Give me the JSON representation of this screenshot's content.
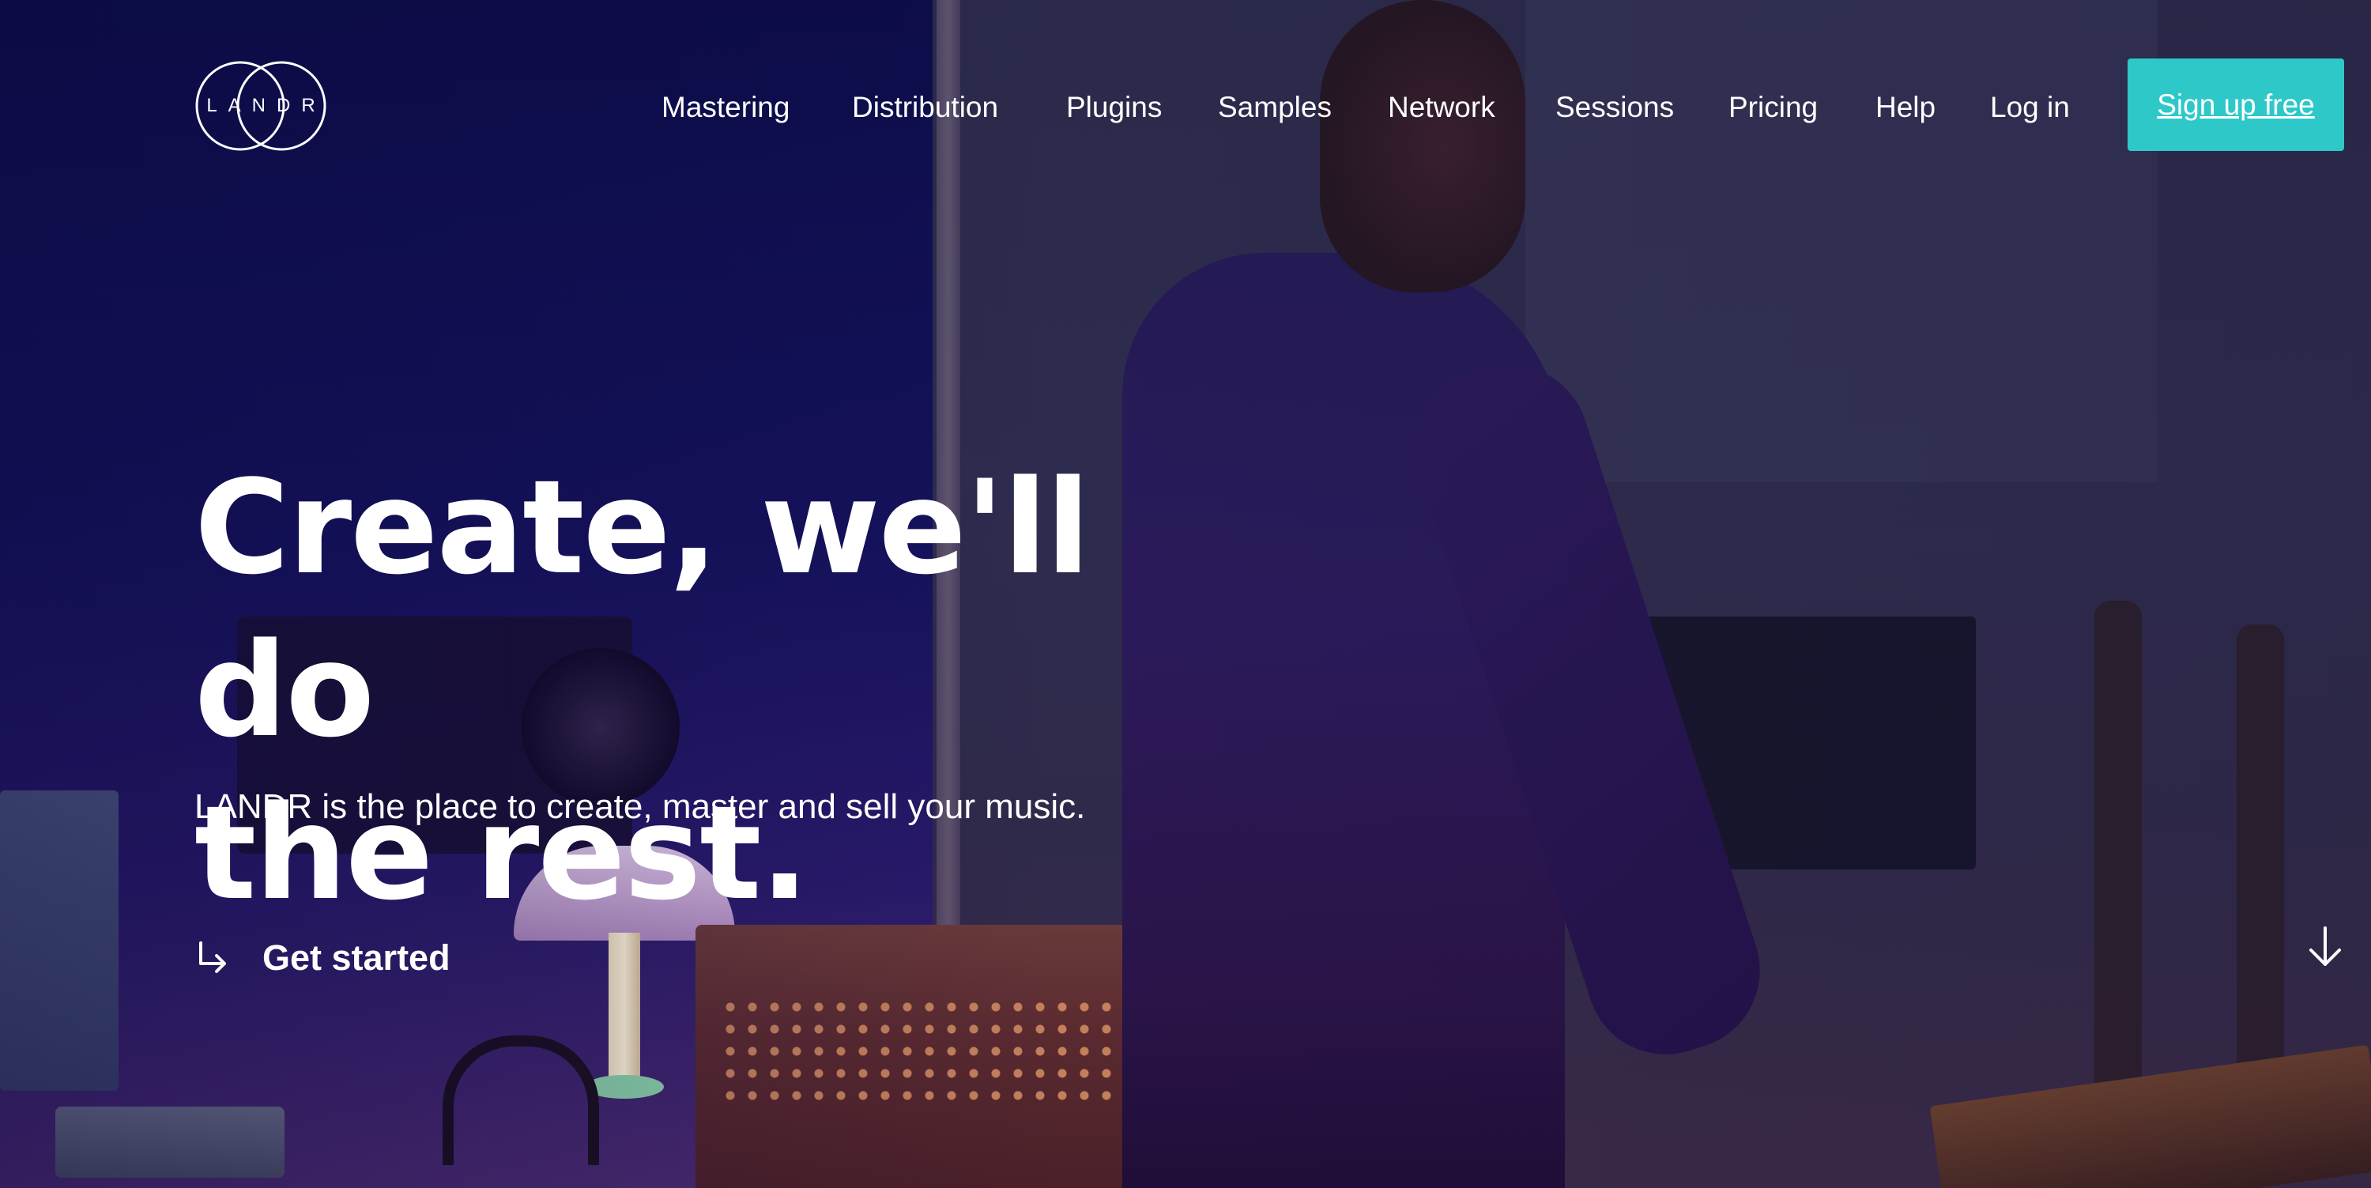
{
  "brand": {
    "logo_text": "LANDR",
    "accent_color": "#2ec8c9"
  },
  "nav": {
    "items": [
      {
        "label": "Mastering"
      },
      {
        "label": "Distribution"
      },
      {
        "label": "Plugins"
      },
      {
        "label": "Samples"
      },
      {
        "label": "Network"
      },
      {
        "label": "Sessions"
      },
      {
        "label": "Pricing"
      },
      {
        "label": "Help"
      },
      {
        "label": "Log in"
      }
    ],
    "signup_label": "Sign up free"
  },
  "hero": {
    "headline_line1": "Create, we'll do",
    "headline_line2": "the rest.",
    "subtitle": "LANDR is the place to create, master and sell your music.",
    "cta_label": "Get started",
    "cta_icon": "arrow-turn-right-icon",
    "scroll_icon": "arrow-down-icon"
  }
}
